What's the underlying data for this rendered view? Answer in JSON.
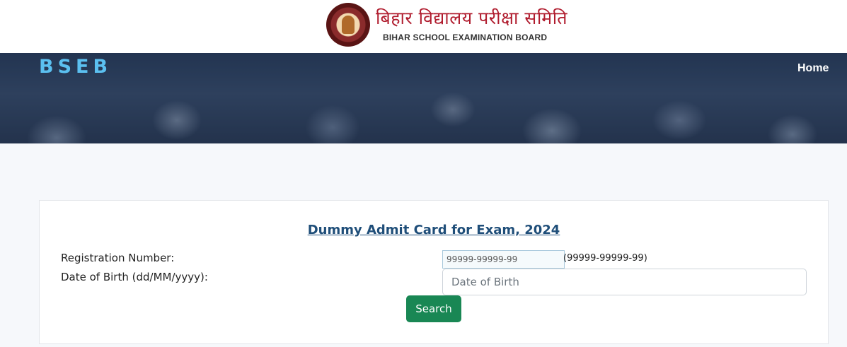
{
  "header": {
    "logo_hindi": "बिहार विद्यालय परीक्षा समिति",
    "logo_english": "BIHAR SCHOOL EXAMINATION BOARD",
    "emblem_icon": "bseb-emblem-icon"
  },
  "navbar": {
    "brand": "BSEB",
    "home_link": "Home"
  },
  "form": {
    "title": "Dummy Admit Card for Exam, 2024",
    "registration_label": "Registration Number:",
    "registration_placeholder": "99999-99999-99",
    "registration_hint": "(99999-99999-99)",
    "dob_label": "Date of Birth (dd/MM/yyyy):",
    "dob_placeholder": "Date of Birth",
    "search_label": "Search"
  },
  "colors": {
    "brand": "#5bc0f0",
    "title": "#1f4e79",
    "search_button": "#198754",
    "logo_hindi": "#b01c2e"
  }
}
